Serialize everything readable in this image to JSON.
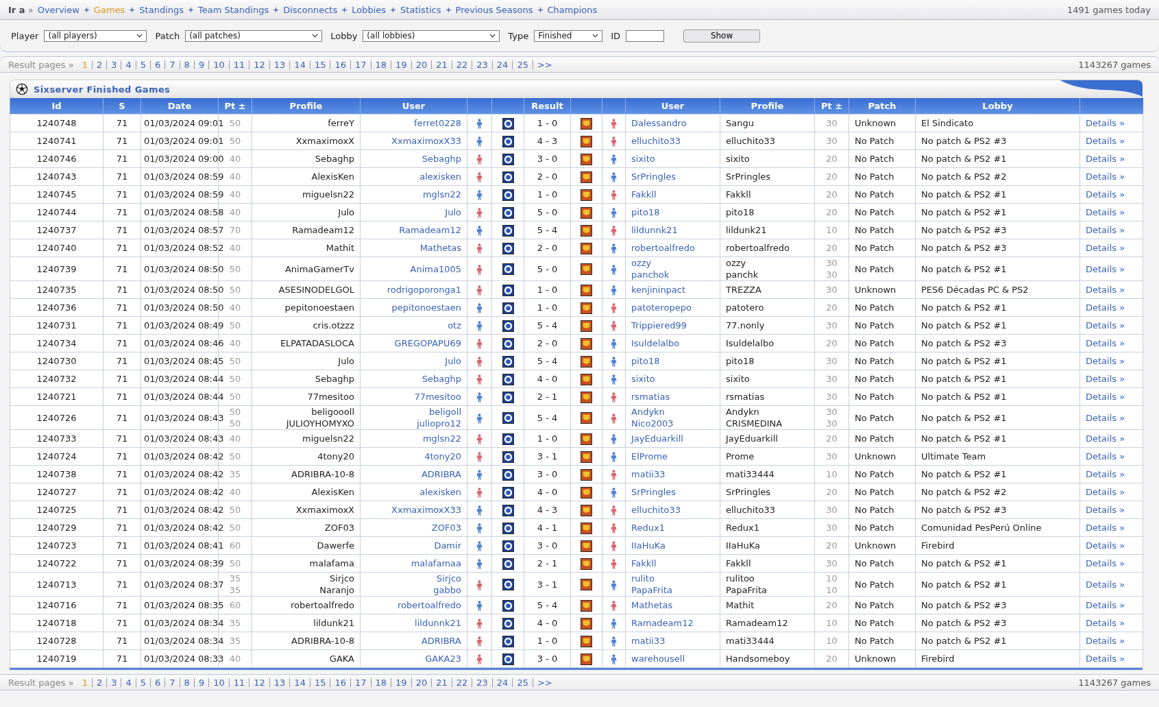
{
  "nav": {
    "lead": "**Ir a** »",
    "items": [
      {
        "label": "Overview",
        "selected": false
      },
      {
        "label": "Games",
        "selected": true
      },
      {
        "label": "Standings",
        "selected": false
      },
      {
        "label": "Team Standings",
        "selected": false
      },
      {
        "label": "Disconnects",
        "selected": false
      },
      {
        "label": "Lobbies",
        "selected": false
      },
      {
        "label": "Statistics",
        "selected": false
      },
      {
        "label": "Previous Seasons",
        "selected": false
      },
      {
        "label": "Champions",
        "selected": false
      }
    ],
    "today": "1491 games today"
  },
  "filters": [
    {
      "label": "Player",
      "value": "(all players)",
      "kind": "select"
    },
    {
      "label": "Patch",
      "value": "(all patches)",
      "kind": "select"
    },
    {
      "label": "Lobby",
      "value": "(all lobbies)",
      "kind": "select"
    },
    {
      "label": "Type",
      "value": "Finished",
      "kind": "select"
    },
    {
      "label": "ID",
      "kind": "text"
    }
  ],
  "show_button": "Show",
  "pages_top": {
    "label": "Result pages »",
    "total": "1143267 games",
    "items": [
      {
        "label": "1",
        "selected": true
      },
      {
        "label": "2",
        "selected": false
      },
      {
        "label": "3",
        "selected": false
      },
      {
        "label": "4",
        "selected": false
      },
      {
        "label": "5",
        "selected": false
      },
      {
        "label": "6",
        "selected": false
      },
      {
        "label": "7",
        "selected": false
      },
      {
        "label": "8",
        "selected": false
      },
      {
        "label": "9",
        "selected": false
      },
      {
        "label": "10",
        "selected": false
      },
      {
        "label": "11",
        "selected": false
      },
      {
        "label": "12",
        "selected": false
      },
      {
        "label": "13",
        "selected": false
      },
      {
        "label": "14",
        "selected": false
      },
      {
        "label": "15",
        "selected": false
      },
      {
        "label": "16",
        "selected": false
      },
      {
        "label": "17",
        "selected": false
      },
      {
        "label": "18",
        "selected": false
      },
      {
        "label": "19",
        "selected": false
      },
      {
        "label": "20",
        "selected": false
      },
      {
        "label": "21",
        "selected": false
      },
      {
        "label": "22",
        "selected": false
      },
      {
        "label": "23",
        "selected": false
      },
      {
        "label": "24",
        "selected": false
      },
      {
        "label": "25",
        "selected": false
      },
      {
        "label": ">>",
        "selected": false
      }
    ]
  },
  "table": {
    "title": "Sixserver Finished Games",
    "columns": [
      "Id",
      "S",
      "Date",
      "Pt ±",
      "Profile",
      "User",
      "",
      "",
      "Result",
      "",
      "",
      "User",
      "Profile",
      "Pt ±",
      "Patch",
      "Lobby",
      ""
    ],
    "rows": [
      {
        "id": "1240748",
        "s": "71",
        "date": "01/03/2024 09:01",
        "home": {
          "pts": [
            "50"
          ],
          "profiles": [
            "ferreY"
          ],
          "users": [
            "ferret0228"
          ],
          "color": "#4a7fd4"
        },
        "result": "1 - 0",
        "away": {
          "pts": [
            "30"
          ],
          "profiles": [
            "Sangu"
          ],
          "users": [
            "Dalessandro"
          ],
          "color": "#d9606c"
        },
        "patch": "Unknown",
        "lobby": "El Sindicato",
        "details": "Details »"
      },
      {
        "id": "1240741",
        "s": "71",
        "date": "01/03/2024 09:01",
        "home": {
          "pts": [
            "50"
          ],
          "profiles": [
            "XxmaximoxX"
          ],
          "users": [
            "XxmaximoxX33"
          ],
          "color": "#4a7fd4"
        },
        "result": "4 - 3",
        "away": {
          "pts": [
            "30"
          ],
          "profiles": [
            "elluchito33"
          ],
          "users": [
            "elluchito33"
          ],
          "color": "#d9606c"
        },
        "patch": "No Patch",
        "lobby": "No patch & PS2 #3",
        "details": "Details »"
      },
      {
        "id": "1240746",
        "s": "71",
        "date": "01/03/2024 09:00",
        "home": {
          "pts": [
            "40"
          ],
          "profiles": [
            "Sebaghp"
          ],
          "users": [
            "Sebaghp"
          ],
          "color": "#d9606c"
        },
        "result": "3 - 0",
        "away": {
          "pts": [
            "20"
          ],
          "profiles": [
            "sixito"
          ],
          "users": [
            "sixito"
          ],
          "color": "#4a7fd4"
        },
        "patch": "No Patch",
        "lobby": "No patch & PS2 #1",
        "details": "Details »"
      },
      {
        "id": "1240743",
        "s": "71",
        "date": "01/03/2024 08:59",
        "home": {
          "pts": [
            "40"
          ],
          "profiles": [
            "AlexisKen"
          ],
          "users": [
            "alexisken"
          ],
          "color": "#d9606c"
        },
        "result": "2 - 0",
        "away": {
          "pts": [
            "20"
          ],
          "profiles": [
            "SrPringles"
          ],
          "users": [
            "SrPringles"
          ],
          "color": "#4a7fd4"
        },
        "patch": "No Patch",
        "lobby": "No patch & PS2 #2",
        "details": "Details »"
      },
      {
        "id": "1240745",
        "s": "71",
        "date": "01/03/2024 08:59",
        "home": {
          "pts": [
            "40"
          ],
          "profiles": [
            "miguelsn22"
          ],
          "users": [
            "mglsn22"
          ],
          "color": "#4a7fd4"
        },
        "result": "1 - 0",
        "away": {
          "pts": [
            "20"
          ],
          "profiles": [
            "Fakkll"
          ],
          "users": [
            "Fakkll"
          ],
          "color": "#d9606c"
        },
        "patch": "No Patch",
        "lobby": "No patch & PS2 #1",
        "details": "Details »"
      },
      {
        "id": "1240744",
        "s": "71",
        "date": "01/03/2024 08:58",
        "home": {
          "pts": [
            "40"
          ],
          "profiles": [
            "Julo"
          ],
          "users": [
            "Julo"
          ],
          "color": "#d9606c"
        },
        "result": "5 - 0",
        "away": {
          "pts": [
            "20"
          ],
          "profiles": [
            "pito18"
          ],
          "users": [
            "pito18"
          ],
          "color": "#4a7fd4"
        },
        "patch": "No Patch",
        "lobby": "No patch & PS2 #1",
        "details": "Details »"
      },
      {
        "id": "1240737",
        "s": "71",
        "date": "01/03/2024 08:57",
        "home": {
          "pts": [
            "70"
          ],
          "profiles": [
            "Ramadeam12"
          ],
          "users": [
            "Ramadeam12"
          ],
          "color": "#4a7fd4"
        },
        "result": "5 - 4",
        "away": {
          "pts": [
            "10"
          ],
          "profiles": [
            "lildunk21"
          ],
          "users": [
            "lildunnk21"
          ],
          "color": "#d9606c"
        },
        "patch": "No Patch",
        "lobby": "No patch & PS2 #3",
        "details": "Details »"
      },
      {
        "id": "1240740",
        "s": "71",
        "date": "01/03/2024 08:52",
        "home": {
          "pts": [
            "40"
          ],
          "profiles": [
            "Mathit"
          ],
          "users": [
            "Mathetas"
          ],
          "color": "#d9606c"
        },
        "result": "2 - 0",
        "away": {
          "pts": [
            "20"
          ],
          "profiles": [
            "robertoalfredo"
          ],
          "users": [
            "robertoalfredo"
          ],
          "color": "#4a7fd4"
        },
        "patch": "No Patch",
        "lobby": "No patch & PS2 #3",
        "details": "Details »"
      },
      {
        "id": "1240739",
        "s": "71",
        "date": "01/03/2024 08:50",
        "home": {
          "pts": [
            "50"
          ],
          "profiles": [
            "AnimaGamerTv"
          ],
          "users": [
            "Anima1005"
          ],
          "color": "#d9606c"
        },
        "result": "5 - 0",
        "away": {
          "pts": [
            "30",
            "30"
          ],
          "profiles": [
            "ozzy",
            "panchk"
          ],
          "users": [
            "ozzy",
            "panchok"
          ],
          "color": "#4a7fd4"
        },
        "patch": "No Patch",
        "lobby": "No patch & PS2 #1",
        "details": "Details »"
      },
      {
        "id": "1240735",
        "s": "71",
        "date": "01/03/2024 08:50",
        "home": {
          "pts": [
            "50"
          ],
          "profiles": [
            "ASESINODELGOL"
          ],
          "users": [
            "rodrigoporonga1"
          ],
          "color": "#d9606c"
        },
        "result": "1 - 0",
        "away": {
          "pts": [
            "30"
          ],
          "profiles": [
            "TREZZA"
          ],
          "users": [
            "kenjininpact"
          ],
          "color": "#4a7fd4"
        },
        "patch": "Unknown",
        "lobby": "PES6 Décadas PC & PS2",
        "details": "Details »"
      },
      {
        "id": "1240736",
        "s": "71",
        "date": "01/03/2024 08:50",
        "home": {
          "pts": [
            "40"
          ],
          "profiles": [
            "pepitonoestaen"
          ],
          "users": [
            "pepitonoestaen"
          ],
          "color": "#4a7fd4"
        },
        "result": "1 - 0",
        "away": {
          "pts": [
            "20"
          ],
          "profiles": [
            "patotero"
          ],
          "users": [
            "patoteropepo"
          ],
          "color": "#d9606c"
        },
        "patch": "No Patch",
        "lobby": "No patch & PS2 #1",
        "details": "Details »"
      },
      {
        "id": "1240731",
        "s": "71",
        "date": "01/03/2024 08:49",
        "home": {
          "pts": [
            "50"
          ],
          "profiles": [
            "cris.otzzz"
          ],
          "users": [
            "otz"
          ],
          "color": "#4a7fd4"
        },
        "result": "5 - 4",
        "away": {
          "pts": [
            "30"
          ],
          "profiles": [
            "77.nonly"
          ],
          "users": [
            "Trippiered99"
          ],
          "color": "#d9606c"
        },
        "patch": "No Patch",
        "lobby": "No patch & PS2 #1",
        "details": "Details »"
      },
      {
        "id": "1240734",
        "s": "71",
        "date": "01/03/2024 08:46",
        "home": {
          "pts": [
            "40"
          ],
          "profiles": [
            "ELPATADASLOCA"
          ],
          "users": [
            "GREGOPAPU69"
          ],
          "color": "#d9606c"
        },
        "result": "2 - 0",
        "away": {
          "pts": [
            "20"
          ],
          "profiles": [
            "Isuldelalbo"
          ],
          "users": [
            "Isuldelalbo"
          ],
          "color": "#4a7fd4"
        },
        "patch": "No Patch",
        "lobby": "No patch & PS2 #3",
        "details": "Details »"
      },
      {
        "id": "1240730",
        "s": "71",
        "date": "01/03/2024 08:45",
        "home": {
          "pts": [
            "50"
          ],
          "profiles": [
            "Julo"
          ],
          "users": [
            "Julo"
          ],
          "color": "#d9606c"
        },
        "result": "5 - 4",
        "away": {
          "pts": [
            "30"
          ],
          "profiles": [
            "pito18"
          ],
          "users": [
            "pito18"
          ],
          "color": "#4a7fd4"
        },
        "patch": "No Patch",
        "lobby": "No patch & PS2 #1",
        "details": "Details »"
      },
      {
        "id": "1240732",
        "s": "71",
        "date": "01/03/2024 08:44",
        "home": {
          "pts": [
            "50"
          ],
          "profiles": [
            "Sebaghp"
          ],
          "users": [
            "Sebaghp"
          ],
          "color": "#d9606c"
        },
        "result": "4 - 0",
        "away": {
          "pts": [
            "30"
          ],
          "profiles": [
            "sixito"
          ],
          "users": [
            "sixito"
          ],
          "color": "#4a7fd4"
        },
        "patch": "No Patch",
        "lobby": "No patch & PS2 #1",
        "details": "Details »"
      },
      {
        "id": "1240721",
        "s": "71",
        "date": "01/03/2024 08:44",
        "home": {
          "pts": [
            "50"
          ],
          "profiles": [
            "77mesitoo"
          ],
          "users": [
            "77mesitoo"
          ],
          "color": "#4a7fd4"
        },
        "result": "2 - 1",
        "away": {
          "pts": [
            "30"
          ],
          "profiles": [
            "rsmatias"
          ],
          "users": [
            "rsmatias"
          ],
          "color": "#d9606c"
        },
        "patch": "No Patch",
        "lobby": "No patch & PS2 #1",
        "details": "Details »"
      },
      {
        "id": "1240726",
        "s": "71",
        "date": "01/03/2024 08:43",
        "home": {
          "pts": [
            "50",
            "50"
          ],
          "profiles": [
            "beligoooll",
            "JULIOYHOMYXO"
          ],
          "users": [
            "beligoll",
            "juliopro12"
          ],
          "color": "#4a7fd4"
        },
        "result": "5 - 4",
        "away": {
          "pts": [
            "30",
            "30"
          ],
          "profiles": [
            "Andykn",
            "CRISMEDINA"
          ],
          "users": [
            "Andykn",
            "Nico2003"
          ],
          "color": "#d9606c"
        },
        "patch": "No Patch",
        "lobby": "No patch & PS2 #1",
        "details": "Details »"
      },
      {
        "id": "1240733",
        "s": "71",
        "date": "01/03/2024 08:43",
        "home": {
          "pts": [
            "40"
          ],
          "profiles": [
            "miguelsn22"
          ],
          "users": [
            "mglsn22"
          ],
          "color": "#d9606c"
        },
        "result": "1 - 0",
        "away": {
          "pts": [
            "20"
          ],
          "profiles": [
            "JayEduarkill"
          ],
          "users": [
            "JayEduarkill"
          ],
          "color": "#4a7fd4"
        },
        "patch": "No Patch",
        "lobby": "No patch & PS2 #1",
        "details": "Details »"
      },
      {
        "id": "1240724",
        "s": "71",
        "date": "01/03/2024 08:42",
        "home": {
          "pts": [
            "50"
          ],
          "profiles": [
            "4tony20"
          ],
          "users": [
            "4tony20"
          ],
          "color": "#d9606c"
        },
        "result": "3 - 1",
        "away": {
          "pts": [
            "30"
          ],
          "profiles": [
            "Prome"
          ],
          "users": [
            "ElProme"
          ],
          "color": "#4a7fd4"
        },
        "patch": "Unknown",
        "lobby": "Ultimate Team",
        "details": "Details »"
      },
      {
        "id": "1240738",
        "s": "71",
        "date": "01/03/2024 08:42",
        "home": {
          "pts": [
            "35"
          ],
          "profiles": [
            "ADRIBRA-10-8"
          ],
          "users": [
            "ADRIBRA"
          ],
          "color": "#4a7fd4"
        },
        "result": "3 - 0",
        "away": {
          "pts": [
            "10"
          ],
          "profiles": [
            "mati33444"
          ],
          "users": [
            "matii33"
          ],
          "color": "#d9606c"
        },
        "patch": "No Patch",
        "lobby": "No patch & PS2 #1",
        "details": "Details »"
      },
      {
        "id": "1240727",
        "s": "71",
        "date": "01/03/2024 08:42",
        "home": {
          "pts": [
            "40"
          ],
          "profiles": [
            "AlexisKen"
          ],
          "users": [
            "alexisken"
          ],
          "color": "#d9606c"
        },
        "result": "4 - 0",
        "away": {
          "pts": [
            "20"
          ],
          "profiles": [
            "SrPringles"
          ],
          "users": [
            "SrPringles"
          ],
          "color": "#4a7fd4"
        },
        "patch": "No Patch",
        "lobby": "No patch & PS2 #2",
        "details": "Details »"
      },
      {
        "id": "1240725",
        "s": "71",
        "date": "01/03/2024 08:42",
        "home": {
          "pts": [
            "50"
          ],
          "profiles": [
            "XxmaximoxX"
          ],
          "users": [
            "XxmaximoxX33"
          ],
          "color": "#4a7fd4"
        },
        "result": "4 - 3",
        "away": {
          "pts": [
            "30"
          ],
          "profiles": [
            "elluchito33"
          ],
          "users": [
            "elluchito33"
          ],
          "color": "#d9606c"
        },
        "patch": "No Patch",
        "lobby": "No patch & PS2 #3",
        "details": "Details »"
      },
      {
        "id": "1240729",
        "s": "71",
        "date": "01/03/2024 08:42",
        "home": {
          "pts": [
            "50"
          ],
          "profiles": [
            "ZOF03"
          ],
          "users": [
            "ZOF03"
          ],
          "color": "#4a7fd4"
        },
        "result": "4 - 1",
        "away": {
          "pts": [
            "30"
          ],
          "profiles": [
            "Redux1"
          ],
          "users": [
            "Redux1"
          ],
          "color": "#d9606c"
        },
        "patch": "No Patch",
        "lobby": "Comunidad PesPerú Online",
        "details": "Details »"
      },
      {
        "id": "1240723",
        "s": "71",
        "date": "01/03/2024 08:41",
        "home": {
          "pts": [
            "60"
          ],
          "profiles": [
            "Dawerfe"
          ],
          "users": [
            "Damir"
          ],
          "color": "#4a7fd4"
        },
        "result": "3 - 0",
        "away": {
          "pts": [
            "20"
          ],
          "profiles": [
            "IIaHuKa"
          ],
          "users": [
            "IIaHuKa"
          ],
          "color": "#d9606c"
        },
        "patch": "Unknown",
        "lobby": "Firebird",
        "details": "Details »"
      },
      {
        "id": "1240722",
        "s": "71",
        "date": "01/03/2024 08:39",
        "home": {
          "pts": [
            "50"
          ],
          "profiles": [
            "malafama"
          ],
          "users": [
            "malafamaa"
          ],
          "color": "#4a7fd4"
        },
        "result": "2 - 1",
        "away": {
          "pts": [
            "30"
          ],
          "profiles": [
            "Fakkll"
          ],
          "users": [
            "Fakkll"
          ],
          "color": "#d9606c"
        },
        "patch": "No Patch",
        "lobby": "No patch & PS2 #1",
        "details": "Details »"
      },
      {
        "id": "1240713",
        "s": "71",
        "date": "01/03/2024 08:37",
        "home": {
          "pts": [
            "35",
            "35"
          ],
          "profiles": [
            "Sirjco",
            "Naranjo"
          ],
          "users": [
            "Sirjco",
            "gabbo"
          ],
          "color": "#d9606c"
        },
        "result": "3 - 1",
        "away": {
          "pts": [
            "10",
            "10"
          ],
          "profiles": [
            "rulitoo",
            "PapaFrita"
          ],
          "users": [
            "rulito",
            "PapaFrita"
          ],
          "color": "#4a7fd4"
        },
        "patch": "No Patch",
        "lobby": "No patch & PS2 #1",
        "details": "Details »"
      },
      {
        "id": "1240716",
        "s": "71",
        "date": "01/03/2024 08:35",
        "home": {
          "pts": [
            "60"
          ],
          "profiles": [
            "robertoalfredo"
          ],
          "users": [
            "robertoalfredo"
          ],
          "color": "#4a7fd4"
        },
        "result": "5 - 4",
        "away": {
          "pts": [
            "20"
          ],
          "profiles": [
            "Mathit"
          ],
          "users": [
            "Mathetas"
          ],
          "color": "#d9606c"
        },
        "patch": "No Patch",
        "lobby": "No patch & PS2 #3",
        "details": "Details »"
      },
      {
        "id": "1240718",
        "s": "71",
        "date": "01/03/2024 08:34",
        "home": {
          "pts": [
            "35"
          ],
          "profiles": [
            "lildunk21"
          ],
          "users": [
            "lildunnk21"
          ],
          "color": "#d9606c"
        },
        "result": "4 - 0",
        "away": {
          "pts": [
            "10"
          ],
          "profiles": [
            "Ramadeam12"
          ],
          "users": [
            "Ramadeam12"
          ],
          "color": "#4a7fd4"
        },
        "patch": "No Patch",
        "lobby": "No patch & PS2 #3",
        "details": "Details »"
      },
      {
        "id": "1240728",
        "s": "71",
        "date": "01/03/2024 08:34",
        "home": {
          "pts": [
            "35"
          ],
          "profiles": [
            "ADRIBRA-10-8"
          ],
          "users": [
            "ADRIBRA"
          ],
          "color": "#d9606c"
        },
        "result": "1 - 0",
        "away": {
          "pts": [
            "10"
          ],
          "profiles": [
            "mati33444"
          ],
          "users": [
            "matii33"
          ],
          "color": "#4a7fd4"
        },
        "patch": "No Patch",
        "lobby": "No patch & PS2 #1",
        "details": "Details »"
      },
      {
        "id": "1240719",
        "s": "71",
        "date": "01/03/2024 08:33",
        "home": {
          "pts": [
            "40"
          ],
          "profiles": [
            "GAKA"
          ],
          "users": [
            "GAKA23"
          ],
          "color": "#d9606c"
        },
        "result": "3 - 0",
        "away": {
          "pts": [
            "20"
          ],
          "profiles": [
            "Handsomeboy"
          ],
          "users": [
            "warehousell"
          ],
          "color": "#4a7fd4"
        },
        "patch": "Unknown",
        "lobby": "Firebird",
        "details": "Details »"
      }
    ]
  },
  "pages_bottom": {
    "label": "Result pages »",
    "total": "1143267 games",
    "items": [
      {
        "label": "1",
        "selected": true
      },
      {
        "label": "2",
        "selected": false
      },
      {
        "label": "3",
        "selected": false
      },
      {
        "label": "4",
        "selected": false
      },
      {
        "label": "5",
        "selected": false
      },
      {
        "label": "6",
        "selected": false
      },
      {
        "label": "7",
        "selected": false
      },
      {
        "label": "8",
        "selected": false
      },
      {
        "label": "9",
        "selected": false
      },
      {
        "label": "10",
        "selected": false
      },
      {
        "label": "11",
        "selected": false
      },
      {
        "label": "12",
        "selected": false
      },
      {
        "label": "13",
        "selected": false
      },
      {
        "label": "14",
        "selected": false
      },
      {
        "label": "15",
        "selected": false
      },
      {
        "label": "16",
        "selected": false
      },
      {
        "label": "17",
        "selected": false
      },
      {
        "label": "18",
        "selected": false
      },
      {
        "label": "19",
        "selected": false
      },
      {
        "label": "20",
        "selected": false
      },
      {
        "label": "21",
        "selected": false
      },
      {
        "label": "22",
        "selected": false
      },
      {
        "label": "23",
        "selected": false
      },
      {
        "label": "24",
        "selected": false
      },
      {
        "label": "25",
        "selected": false
      },
      {
        "label": ">>",
        "selected": false
      }
    ]
  }
}
